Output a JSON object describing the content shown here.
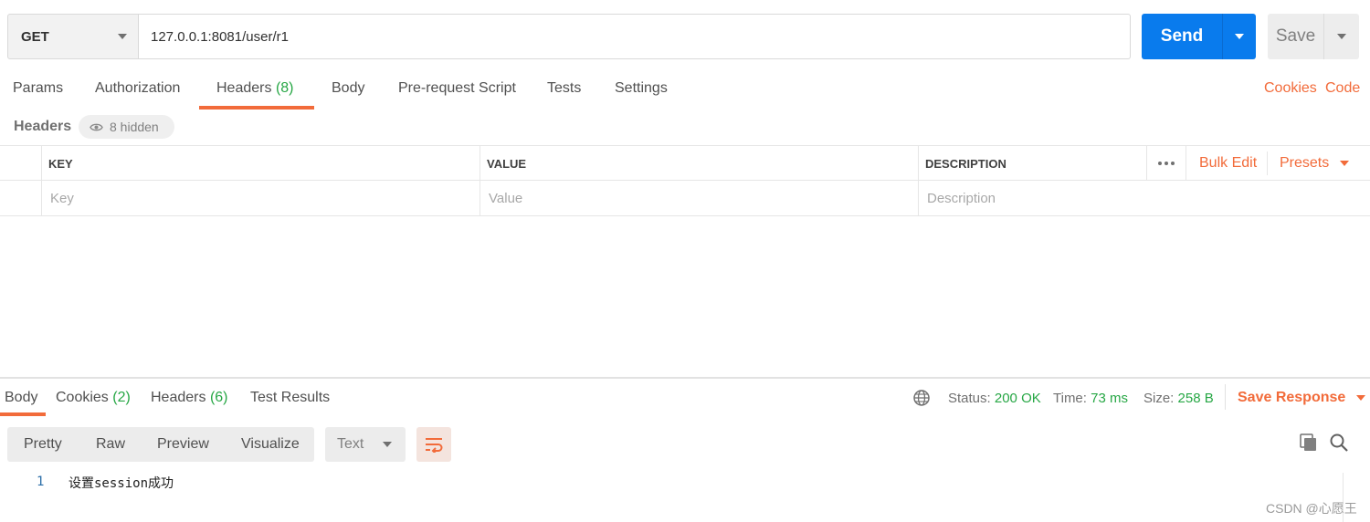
{
  "request": {
    "method": "GET",
    "url": "127.0.0.1:8081/user/r1",
    "send_label": "Send",
    "save_label": "Save"
  },
  "request_tabs": [
    {
      "label": "Params"
    },
    {
      "label": "Authorization"
    },
    {
      "label": "Headers",
      "count": "(8)",
      "active": true
    },
    {
      "label": "Body"
    },
    {
      "label": "Pre-request Script"
    },
    {
      "label": "Tests"
    },
    {
      "label": "Settings"
    }
  ],
  "links": {
    "cookies": "Cookies",
    "code": "Code"
  },
  "headers_section": {
    "title": "Headers",
    "hidden": "8 hidden"
  },
  "table": {
    "columns": [
      "KEY",
      "VALUE",
      "DESCRIPTION"
    ],
    "bulk_edit": "Bulk Edit",
    "presets": "Presets",
    "placeholders": {
      "key": "Key",
      "value": "Value",
      "description": "Description"
    }
  },
  "response_tabs": [
    {
      "label": "Body",
      "active": true
    },
    {
      "label": "Cookies",
      "count": "(2)"
    },
    {
      "label": "Headers",
      "count": "(6)"
    },
    {
      "label": "Test Results"
    }
  ],
  "response_status": {
    "status_label": "Status:",
    "status_value": "200 OK",
    "time_label": "Time:",
    "time_value": "73 ms",
    "size_label": "Size:",
    "size_value": "258 B",
    "save_response": "Save Response"
  },
  "format": {
    "modes": [
      "Pretty",
      "Raw",
      "Preview",
      "Visualize"
    ],
    "language": "Text"
  },
  "body": {
    "lines": [
      {
        "number": "1",
        "text": "设置session成功"
      }
    ]
  },
  "watermark": "CSDN @心愿王",
  "colors": {
    "accent": "#f26b3a",
    "send": "#097bed",
    "success": "#27a745"
  },
  "icons": [
    "chevron-down-icon",
    "eye-icon",
    "more-icon",
    "globe-icon",
    "wrap-lines-icon",
    "copy-icon",
    "search-icon"
  ]
}
